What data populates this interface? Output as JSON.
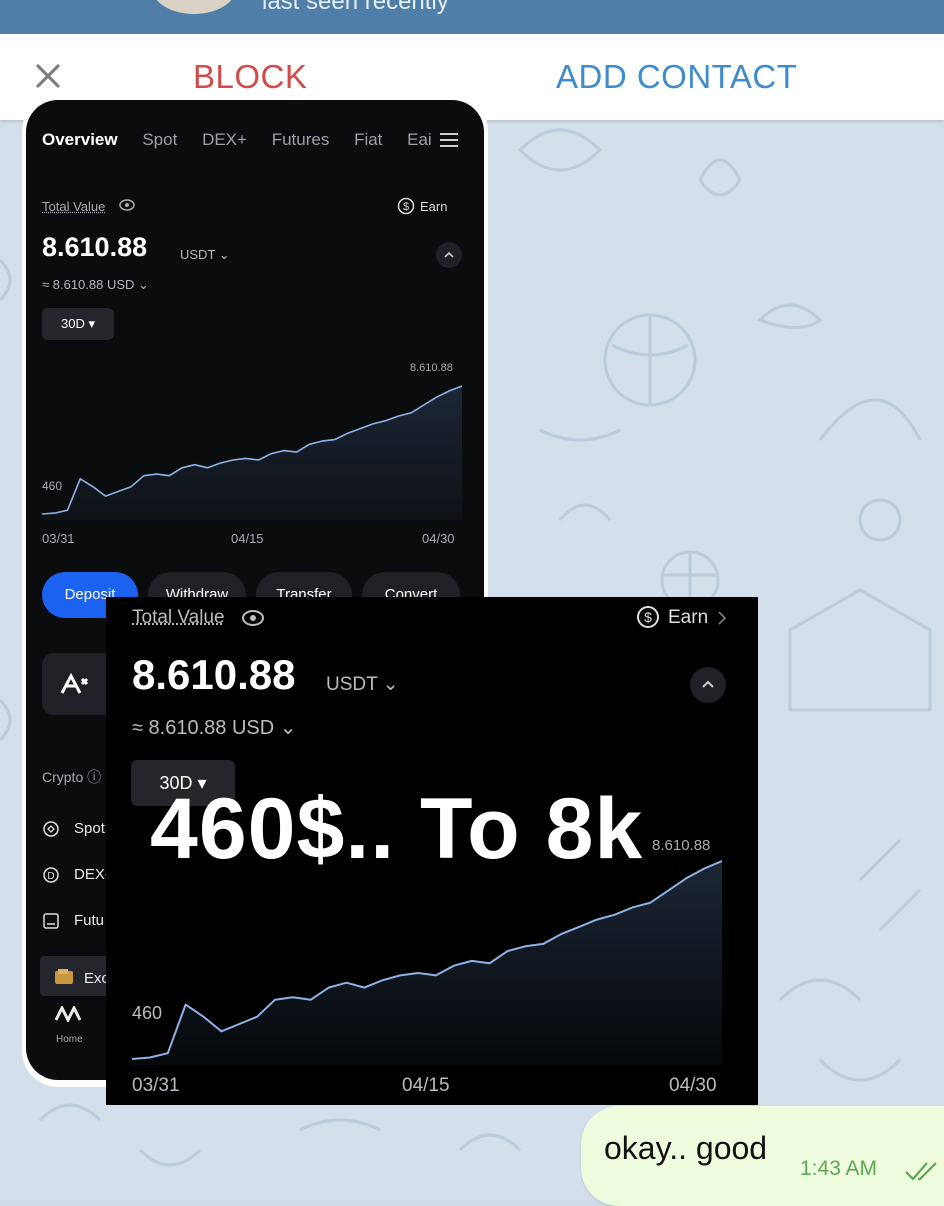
{
  "header": {
    "status": "last seen recently",
    "block_label": "BLOCK",
    "add_contact_label": "ADD CONTACT"
  },
  "screenshot1": {
    "tabs": [
      "Overview",
      "Spot",
      "DEX+",
      "Futures",
      "Fiat",
      "Eai"
    ],
    "total_value_label": "Total Value",
    "earn_label": "Earn",
    "total_value": "8.610.88",
    "currency": "USDT ⌄",
    "usd_value": "≈ 8.610.88 USD ⌄",
    "range": "30D ▾",
    "chart_max_label": "8.610.88",
    "chart_min_label": "460",
    "x_labels": [
      "03/31",
      "04/15",
      "04/30"
    ],
    "buttons": [
      "Deposit",
      "Withdraw",
      "Transfer",
      "Convert"
    ],
    "crypto_label": "Crypto ⓘ",
    "list": [
      "Spot",
      "DEX-",
      "Futu",
      "Exc"
    ],
    "home_label": "Home"
  },
  "screenshot2": {
    "total_value_label": "Total Value",
    "earn_label": "Earn",
    "total_value": "8.610.88",
    "currency": "USDT ⌄",
    "usd_value": "≈ 8.610.88 USD ⌄",
    "range": "30D ▾",
    "chart_max_label": "8.610.88",
    "chart_min_label": "460",
    "x_labels": [
      "03/31",
      "04/15",
      "04/30"
    ]
  },
  "overlay_caption": "460$.. To 8k",
  "message": {
    "text": "okay.. good",
    "time": "1:43 AM"
  },
  "chart_data": [
    {
      "type": "area",
      "x": [
        "03/31",
        "04/15",
        "04/30"
      ],
      "x_range": [
        "03/31",
        "04/30"
      ],
      "min_label": 460,
      "max_label": 8610.88,
      "series": [
        {
          "values": [
            460,
            520,
            700,
            2700,
            2200,
            1600,
            1900,
            2200,
            2900,
            3000,
            2900,
            3400,
            3600,
            3400,
            3700,
            3900,
            4000,
            3900,
            4300,
            4500,
            4400,
            4900,
            5100,
            5200,
            5600,
            5900,
            6200,
            6400,
            6700,
            6900,
            7400,
            7900,
            8300,
            8610.88
          ]
        }
      ],
      "colors": {
        "line": "#8fb2e6",
        "fill": "#1c2636"
      }
    }
  ]
}
